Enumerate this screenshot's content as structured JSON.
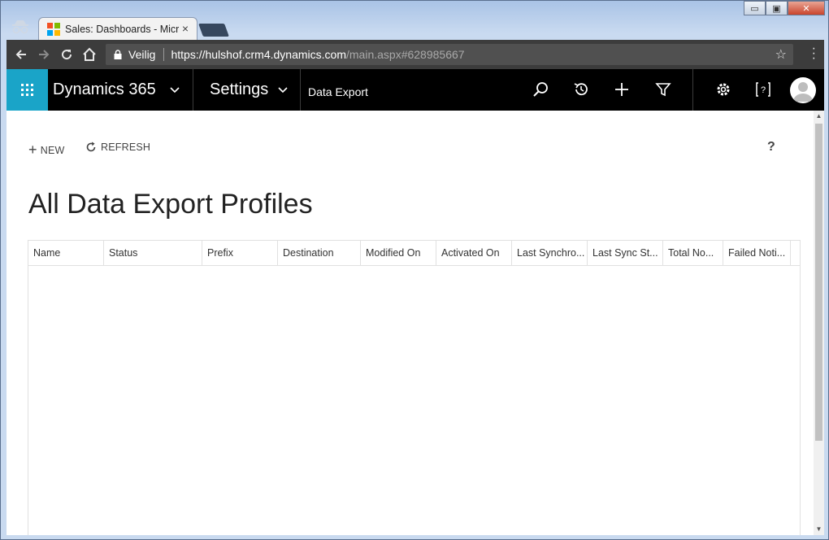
{
  "browser": {
    "tab_title": "Sales: Dashboards - Micr",
    "tab_close": "×",
    "secure_label": "Veilig",
    "url_host": "https://hulshof.crm4.dynamics.com",
    "url_path": "/main.aspx#628985667",
    "window_buttons": {
      "minimize": "▭",
      "maximize": "▣",
      "close": "✕"
    }
  },
  "nav": {
    "brand": "Dynamics 365",
    "area": "Settings",
    "breadcrumb": "Data Export"
  },
  "commands": {
    "new_label": "NEW",
    "refresh_label": "REFRESH",
    "help_label": "?"
  },
  "page": {
    "title": "All Data Export Profiles"
  },
  "grid": {
    "columns": [
      "Name",
      "Status",
      "Prefix",
      "Destination",
      "Modified On",
      "Activated On",
      "Last Synchro...",
      "Last Sync St...",
      "Total No...",
      "Failed Noti..."
    ],
    "rows": []
  },
  "colors": {
    "waffle_bg": "#1aa4c8",
    "nav_bg": "#000000",
    "toolbar_bg": "#3c3c3c"
  }
}
